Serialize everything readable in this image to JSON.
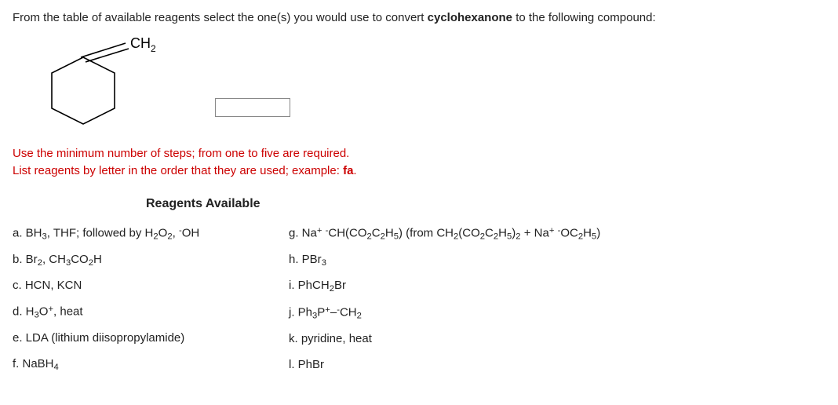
{
  "question": {
    "prefix": "From the table of available reagents select the one(s) you would use to convert ",
    "bold_word": "cyclohexanone",
    "suffix": " to the following compound:"
  },
  "structure_label": "CH2",
  "instructions": {
    "line1": "Use the minimum number of steps; from one to five are required.",
    "line2_prefix": "List reagents by letter in the order that they are used; example: ",
    "line2_bold": "fa",
    "line2_suffix": "."
  },
  "reagents_header": "Reagents Available",
  "reagents": {
    "left": [
      {
        "letter": "a.",
        "html": "BH<sub>3</sub>, THF; followed by H<sub>2</sub>O<sub>2</sub>, <sup>-</sup>OH"
      },
      {
        "letter": "b.",
        "html": "Br<sub>2</sub>, CH<sub>3</sub>CO<sub>2</sub>H"
      },
      {
        "letter": "c.",
        "html": "HCN, KCN"
      },
      {
        "letter": "d.",
        "html": "H<sub>3</sub>O<sup>+</sup>, heat"
      },
      {
        "letter": "e.",
        "html": "LDA (lithium diisopropylamide)"
      },
      {
        "letter": "f.",
        "html": "NaBH<sub>4</sub>"
      }
    ],
    "right": [
      {
        "letter": "g.",
        "html": "Na<sup>+</sup> <sup>-</sup>CH(CO<sub>2</sub>C<sub>2</sub>H<sub>5</sub>) (from CH<sub>2</sub>(CO<sub>2</sub>C<sub>2</sub>H<sub>5</sub>)<sub>2</sub> + Na<sup>+</sup> <sup>-</sup>OC<sub>2</sub>H<sub>5</sub>)"
      },
      {
        "letter": "h.",
        "html": "PBr<sub>3</sub>"
      },
      {
        "letter": "i.",
        "html": "PhCH<sub>2</sub>Br"
      },
      {
        "letter": "j.",
        "html": "Ph<sub>3</sub>P<sup>+</sup>–<sup>-</sup>CH<sub>2</sub>"
      },
      {
        "letter": "k.",
        "html": "pyridine, heat"
      },
      {
        "letter": "l.",
        "html": "PhBr"
      }
    ]
  }
}
